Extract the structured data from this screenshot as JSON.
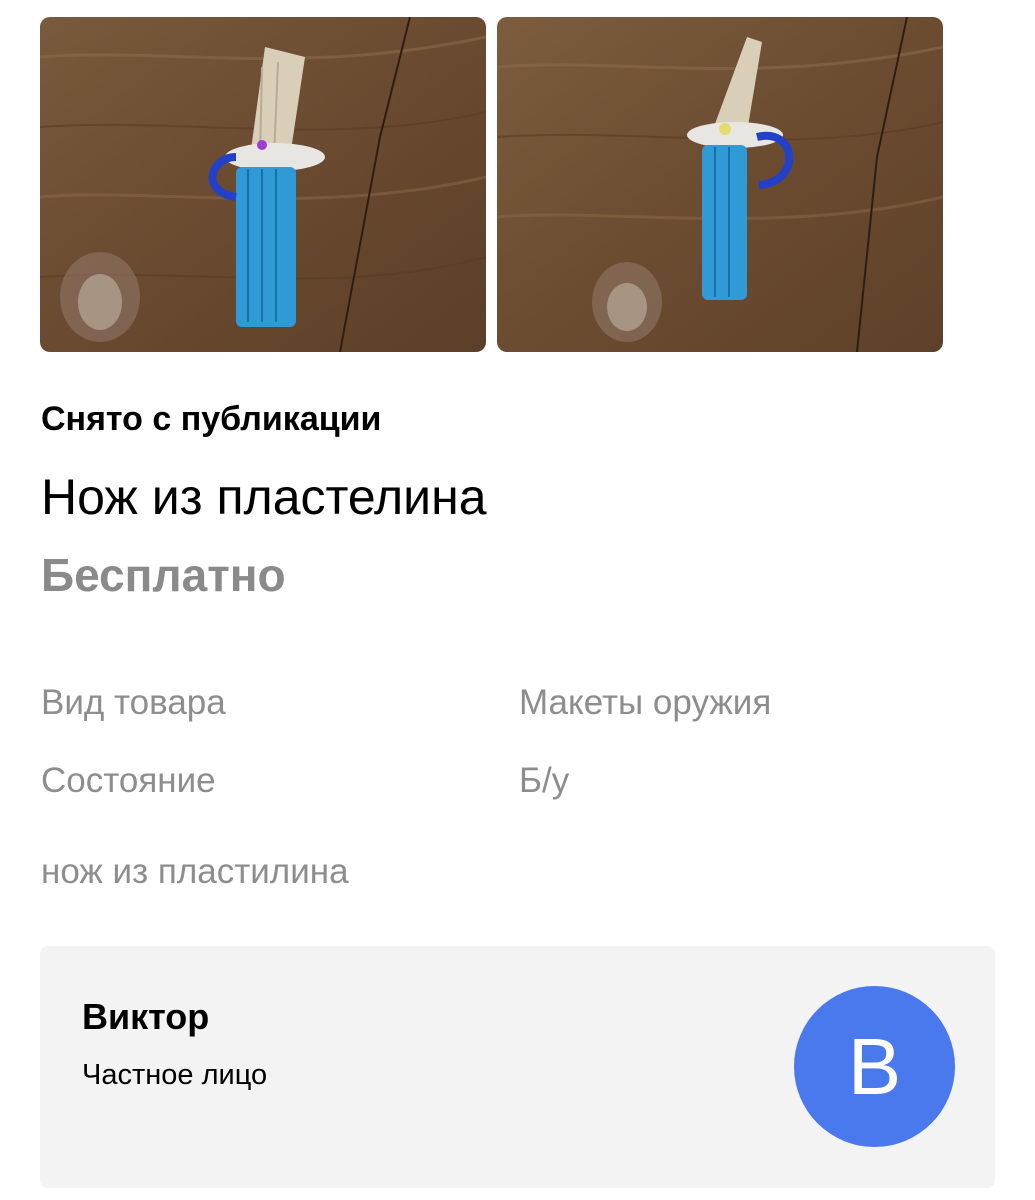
{
  "listing": {
    "status": "Снято с публикации",
    "title": "Нож из пластелина",
    "price": "Бесплатно",
    "params": [
      {
        "key": "Вид товара",
        "value": "Макеты оружия"
      },
      {
        "key": "Состояние",
        "value": "Б/у"
      }
    ],
    "description": "нож из пластилина"
  },
  "seller": {
    "name": "Виктор",
    "type": "Частное лицо",
    "avatar_letter": "В",
    "avatar_color": "#4a78ed"
  },
  "gallery": {
    "photos": [
      "plasticine-knife-photo-1",
      "plasticine-knife-photo-2"
    ]
  }
}
